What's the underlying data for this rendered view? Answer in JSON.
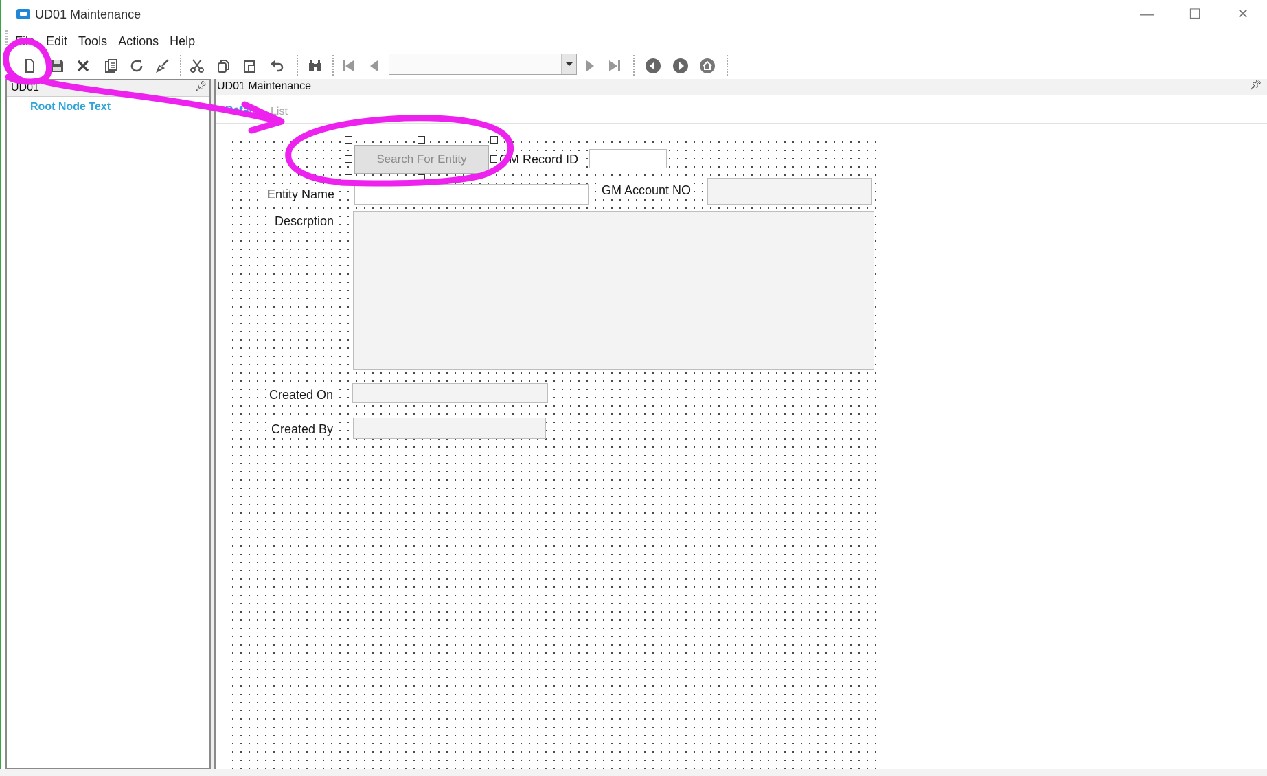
{
  "window": {
    "title": "UD01 Maintenance",
    "controls": {
      "minimize": "—",
      "maximize": "☐",
      "close": "✕"
    }
  },
  "menu": [
    "File",
    "Edit",
    "Tools",
    "Actions",
    "Help"
  ],
  "toolbar": {
    "icons": [
      "new-icon",
      "save-icon",
      "delete-icon",
      "attach-icon",
      "refresh-icon",
      "clear-icon",
      "cut-icon",
      "copy-icon",
      "paste-icon",
      "undo-icon",
      "search-icon",
      "first-record-icon",
      "previous-record-icon",
      "next-record-icon",
      "last-record-icon",
      "back-icon",
      "forward-icon",
      "home-icon"
    ],
    "record_combo_value": ""
  },
  "tree": {
    "title": "UD01",
    "root_node": "Root Node Text"
  },
  "main": {
    "title": "UD01 Maintenance",
    "tabs": [
      "Detail",
      "List"
    ]
  },
  "form": {
    "search_button": "Search For Entity",
    "gm_record_id_label": "GM Record ID",
    "gm_record_id_value": "",
    "entity_name_label": "Entity Name",
    "entity_name_value": "",
    "gm_account_no_label": "GM Account NO",
    "gm_account_no_value": "",
    "description_label": "Descrption",
    "description_value": "",
    "created_on_label": "Created On",
    "created_on_value": "",
    "created_by_label": "Created By",
    "created_by_value": ""
  },
  "colors": {
    "annotation": "#ee22ee",
    "accent": "#2ea4d9",
    "window_edge": "#3aa34a"
  }
}
